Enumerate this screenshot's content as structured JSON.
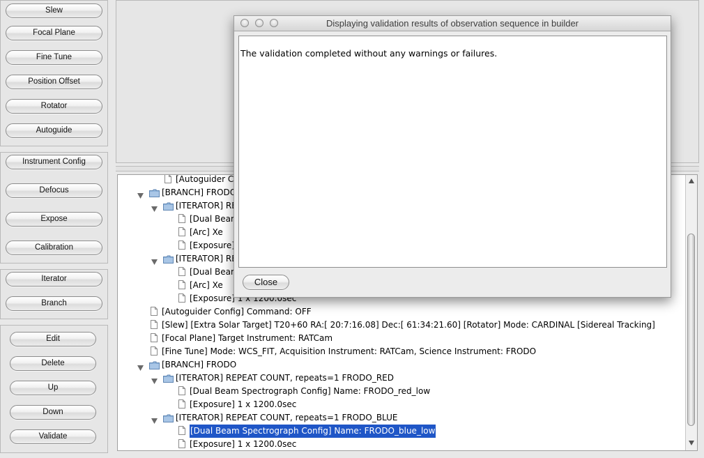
{
  "sidebar": {
    "group1": [
      "Slew",
      "Focal Plane",
      "Fine Tune",
      "Position Offset",
      "Rotator",
      "Autoguide"
    ],
    "group2": [
      "Instrument Config",
      "Defocus",
      "Expose",
      "Calibration"
    ],
    "group3": [
      "Iterator",
      "Branch"
    ],
    "group4": [
      "Edit",
      "Delete",
      "Up",
      "Down",
      "Validate"
    ]
  },
  "tree": {
    "rows": [
      {
        "text": "[Autoguider Config",
        "type": "doc",
        "level": 1
      },
      {
        "text": "[BRANCH] FRODO",
        "type": "folder",
        "level": 0
      },
      {
        "text": "[ITERATOR] REP",
        "type": "folder",
        "level": 1
      },
      {
        "text": "[Dual Beam",
        "type": "doc",
        "level": 2
      },
      {
        "text": "[Arc] Xe",
        "type": "doc",
        "level": 2
      },
      {
        "text": "[Exposure]",
        "type": "doc",
        "level": 2
      },
      {
        "text": "[ITERATOR] REP",
        "type": "folder",
        "level": 1
      },
      {
        "text": "[Dual Beam",
        "type": "doc",
        "level": 2
      },
      {
        "text": "[Arc] Xe",
        "type": "doc",
        "level": 2
      },
      {
        "text": "[Exposure] 1 x 1200.0sec",
        "type": "doc",
        "level": 2
      },
      {
        "text": "[Autoguider Config] Command: OFF",
        "type": "doc",
        "level": 0
      },
      {
        "text": "[Slew] [Extra Solar Target] T20+60 RA:[ 20:7:16.08] Dec:[ 61:34:21.60] [Rotator] Mode: CARDINAL [Sidereal Tracking]",
        "type": "doc",
        "level": 0
      },
      {
        "text": "[Focal Plane] Target Instrument: RATCam",
        "type": "doc",
        "level": 0
      },
      {
        "text": "[Fine Tune] Mode: WCS_FIT, Acquisition Instrument: RATCam, Science Instrument: FRODO",
        "type": "doc",
        "level": 0
      },
      {
        "text": "[BRANCH] FRODO",
        "type": "folder",
        "level": 0
      },
      {
        "text": "[ITERATOR] REPEAT COUNT, repeats=1 FRODO_RED",
        "type": "folder",
        "level": 1
      },
      {
        "text": "[Dual Beam Spectrograph Config] Name: FRODO_red_low",
        "type": "doc",
        "level": 2
      },
      {
        "text": "[Exposure] 1 x 1200.0sec",
        "type": "doc",
        "level": 2
      },
      {
        "text": "[ITERATOR] REPEAT COUNT, repeats=1 FRODO_BLUE",
        "type": "folder",
        "level": 1
      },
      {
        "text": "[Dual Beam Spectrograph Config] Name: FRODO_blue_low",
        "type": "doc",
        "level": 2,
        "selected": true
      },
      {
        "text": "[Exposure] 1 x 1200.0sec",
        "type": "doc",
        "level": 2
      }
    ]
  },
  "dialog": {
    "title": "Displaying validation results of observation sequence in builder",
    "message": "The validation completed without any warnings or failures.",
    "close_label": "Close"
  },
  "colors": {
    "selection": "#1f56c7",
    "folder": "#8fb3da",
    "window_bg": "#e8e8e8"
  }
}
